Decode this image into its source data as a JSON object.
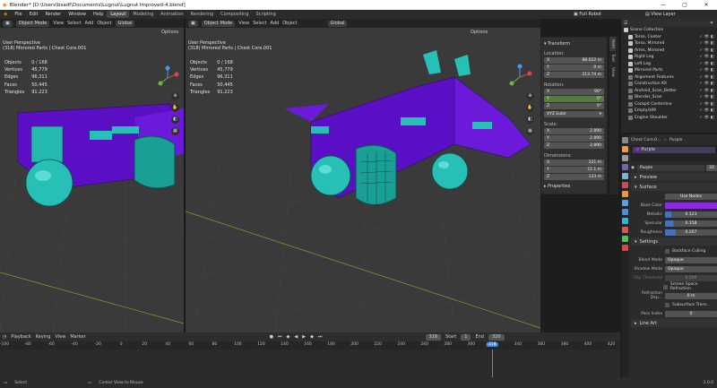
{
  "window": {
    "title": "Blender* [D:\\Users\\bsadf\\Documents\\Lugnut\\Lugnut Improved-4.blend]",
    "controls": [
      "—",
      "▢",
      "✕"
    ]
  },
  "menubar": {
    "menus": [
      "File",
      "Edit",
      "Render",
      "Window",
      "Help"
    ],
    "workspaces": [
      "Layout",
      "Modeling",
      "Animation",
      "Rendering",
      "Compositing",
      "Scripting"
    ],
    "active_workspace": "Layout",
    "scene": "Full Robot",
    "view_layer": "View Layer"
  },
  "viewport_left": {
    "mode": "Object Mode",
    "menus": [
      "View",
      "Select",
      "Add",
      "Object"
    ],
    "transform": "Global",
    "options": "Options",
    "perspective": "User Perspective",
    "context": "(318) Mirrored Parts | Chest Core.001",
    "stats": [
      {
        "k": "Objects",
        "v": "0 / 168"
      },
      {
        "k": "Vertices",
        "v": "45,779"
      },
      {
        "k": "Edges",
        "v": "96,311"
      },
      {
        "k": "Faces",
        "v": "50,445"
      },
      {
        "k": "Triangles",
        "v": "91,223"
      }
    ]
  },
  "viewport_right": {
    "mode": "Object Mode",
    "menus": [
      "View",
      "Select",
      "Add",
      "Object"
    ],
    "transform": "Global",
    "options": "Options",
    "perspective": "User Perspective",
    "context": "(318) Mirrored Parts | Chest Core.001",
    "stats": [
      {
        "k": "Objects",
        "v": "0 / 168"
      },
      {
        "k": "Vertices",
        "v": "45,779"
      },
      {
        "k": "Edges",
        "v": "96,311"
      },
      {
        "k": "Faces",
        "v": "50,445"
      },
      {
        "k": "Triangles",
        "v": "91,223"
      }
    ]
  },
  "npanel": {
    "title": "Transform",
    "location_label": "Location:",
    "location": [
      {
        "k": "X",
        "v": "88.022 m"
      },
      {
        "k": "Y",
        "v": "0 m"
      },
      {
        "k": "Z",
        "v": "213.74 m"
      }
    ],
    "rotation_label": "Rotation:",
    "rotation": [
      {
        "k": "X",
        "v": "90°"
      },
      {
        "k": "Y",
        "v": "0°"
      },
      {
        "k": "Z",
        "v": "0°"
      }
    ],
    "euler": "XYZ Euler",
    "scale_label": "Scale:",
    "scale": [
      {
        "k": "X",
        "v": "2.890"
      },
      {
        "k": "Y",
        "v": "2.890"
      },
      {
        "k": "Z",
        "v": "2.890"
      }
    ],
    "dimensions_label": "Dimensions:",
    "dimensions": [
      {
        "k": "X",
        "v": "121 m"
      },
      {
        "k": "Y",
        "v": "72.1 m"
      },
      {
        "k": "Z",
        "v": "133 m"
      }
    ],
    "properties": "Properties",
    "tabs": [
      "Item",
      "Tool",
      "View"
    ]
  },
  "outliner": {
    "root": "Scene Collection",
    "items": [
      {
        "name": "Torso, Center",
        "color": "#c7c7c7"
      },
      {
        "name": "Torso, Mirrored",
        "color": "#c7c7c7"
      },
      {
        "name": "Arms, Mirrored",
        "color": "#c7c7c7"
      },
      {
        "name": "Right Leg",
        "color": "#c7c7c7"
      },
      {
        "name": "Left Leg",
        "color": "#c7c7c7"
      },
      {
        "name": "Mirrored Parts",
        "color": "#c7c7c7"
      },
      {
        "name": "Alignment Features",
        "color": "#777777"
      },
      {
        "name": "Construction Kit",
        "color": "#777777"
      },
      {
        "name": "Android_Scan_Better",
        "color": "#777777"
      },
      {
        "name": "Blender_Scan",
        "color": "#777777"
      },
      {
        "name": "Cockpit Centerline",
        "color": "#777777"
      },
      {
        "name": "Empty.049",
        "color": "#777777"
      },
      {
        "name": "Engine Shoulder",
        "color": "#777777"
      }
    ]
  },
  "properties": {
    "object": "Chest Core.0...",
    "material": "Purple",
    "slot": "Purple",
    "mat_name": "Purple",
    "users": "20",
    "preview": "Preview",
    "surface": "Surface",
    "use_nodes": "Use Nodes",
    "base_color_label": "Base Color",
    "base_color": "#8a2be2",
    "fields": [
      {
        "k": "Metallic",
        "v": "0.123"
      },
      {
        "k": "Specular",
        "v": "0.158"
      },
      {
        "k": "Roughness",
        "v": "0.207"
      }
    ],
    "settings": "Settings",
    "backface": "Backface Culling",
    "blend_mode_label": "Blend Mode",
    "blend_mode": "Opaque",
    "shadow_mode_label": "Shadow Mode",
    "shadow_mode": "Opaque",
    "clip_label": "Clip Threshold",
    "clip": "0.500",
    "screen_space": "Screen Space Refraction",
    "refraction_label": "Refraction Dep...",
    "refraction": "0 m",
    "subsurface": "Subsurface Trans...",
    "pass_label": "Pass Index",
    "pass": "0",
    "line_art": "Line Art"
  },
  "timeline": {
    "menus": [
      "Playback",
      "Keying",
      "View",
      "Marker"
    ],
    "current_frame": "318",
    "start_label": "Start",
    "start": "1",
    "end_label": "End",
    "end": "320",
    "ticks": [
      "-100",
      "-80",
      "-60",
      "-40",
      "-20",
      "0",
      "20",
      "40",
      "60",
      "80",
      "100",
      "120",
      "140",
      "160",
      "180",
      "200",
      "220",
      "240",
      "260",
      "280",
      "300",
      "318",
      "340",
      "360",
      "380",
      "400",
      "420"
    ]
  },
  "statusbar": {
    "select": "Select",
    "center": "Center View to Mouse",
    "version": "3.0.0"
  },
  "colors": {
    "teal": "#27c0b6",
    "purple": "#6a0fd6",
    "selected_frame": "#4a8fe0"
  }
}
